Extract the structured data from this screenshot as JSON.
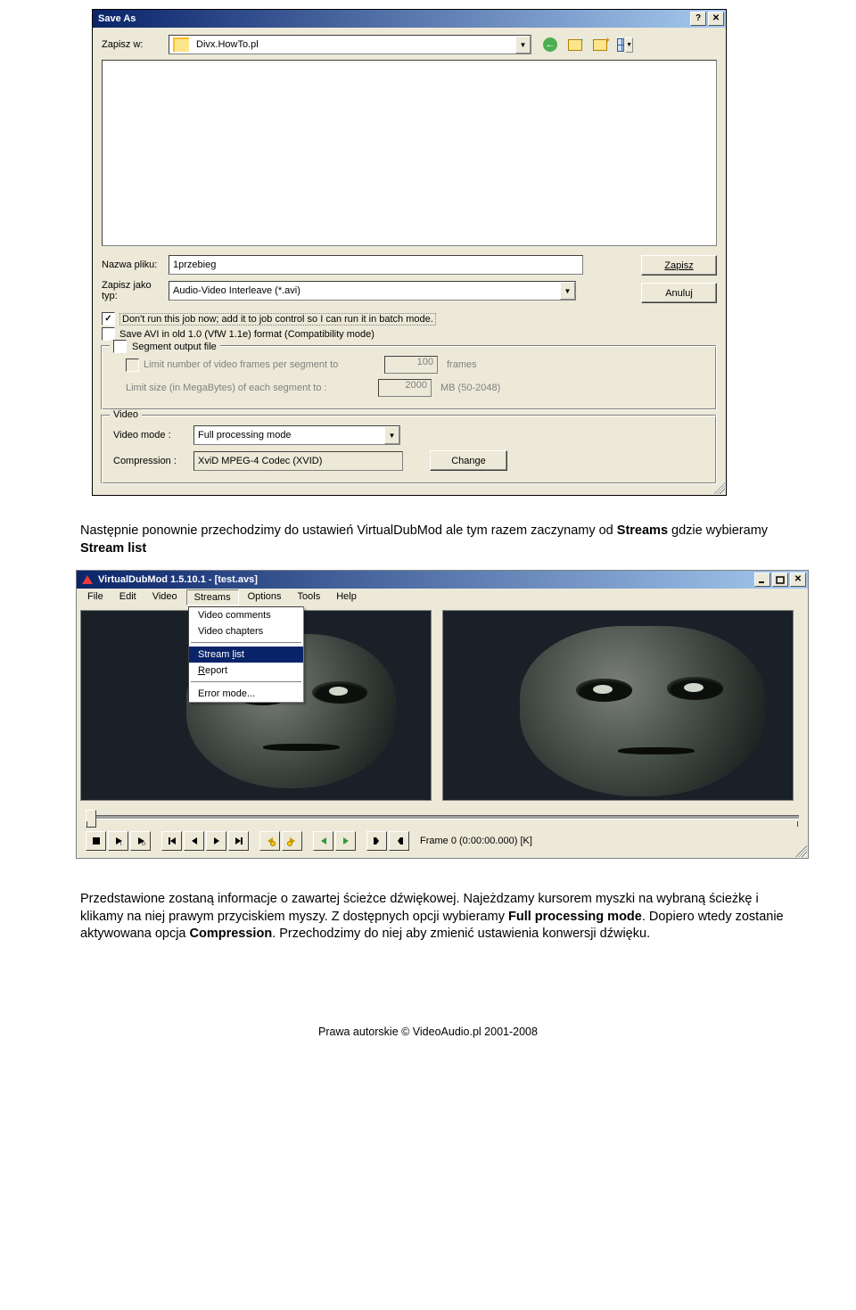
{
  "saveAs": {
    "title": "Save As",
    "lookInLabel": "Zapisz w:",
    "lookInValue": "Divx.HowTo.pl",
    "fileNameLabel": "Nazwa pliku:",
    "fileNameValue": "1przebieg",
    "saveTypeLabel1": "Zapisz jako",
    "saveTypeLabel2": "typ:",
    "saveTypeValue": "Audio-Video Interleave (*.avi)",
    "saveBtn": "Zapisz",
    "cancelBtn": "Anuluj",
    "chkBatch": "Don't run this job now; add it to job control so I can run it in batch mode.",
    "chkCompat": "Save AVI in old 1.0 (VfW 1.1e) format (Compatibility mode)",
    "segment": {
      "legend": "Segment output file",
      "limitFramesLabel": "Limit number of video frames per segment to",
      "limitFramesValue": "100",
      "limitFramesUnit": "frames",
      "limitSizeLabel": "Limit size (in MegaBytes) of each segment to :",
      "limitSizeValue": "2000",
      "limitSizeUnit": "MB (50-2048)"
    },
    "video": {
      "legend": "Video",
      "modeLabel": "Video mode :",
      "modeValue": "Full processing mode",
      "compLabel": "Compression :",
      "compValue": "XviD MPEG-4 Codec (XVID)",
      "changeBtn": "Change"
    }
  },
  "para1": {
    "pre": "Następnie ponownie przechodzimy do ustawień VirtualDubMod ale tym razem zaczynamy od ",
    "b1": "Streams",
    "mid": " gdzie wybieramy ",
    "b2": "Stream list"
  },
  "vdm": {
    "title": "VirtualDubMod 1.5.10.1 - [test.avs]",
    "menus": [
      "File",
      "Edit",
      "Video",
      "Streams",
      "Options",
      "Tools",
      "Help"
    ],
    "dropdown": {
      "items": [
        "Video comments",
        "Video chapters",
        "Stream list",
        "Report",
        "Error mode..."
      ],
      "highlighted": 2,
      "sepAfter": [
        1,
        3
      ]
    },
    "status": "Frame 0 (0:00:00.000) [K]"
  },
  "para2": {
    "t1": "Przedstawione zostaną informacje o zawartej ścieżce dźwiękowej. Najeżdzamy kursorem myszki na wybraną ścieżkę i klikamy na niej prawym przyciskiem myszy. Z dostępnych opcji wybieramy ",
    "b1": "Full processing mode",
    "t2": ". Dopiero wtedy zostanie aktywowana opcja ",
    "b2": "Compression",
    "t3": ". Przechodzimy do niej aby zmienić ustawienia konwersji dźwięku."
  },
  "footer": "Prawa autorskie © VideoAudio.pl 2001-2008"
}
